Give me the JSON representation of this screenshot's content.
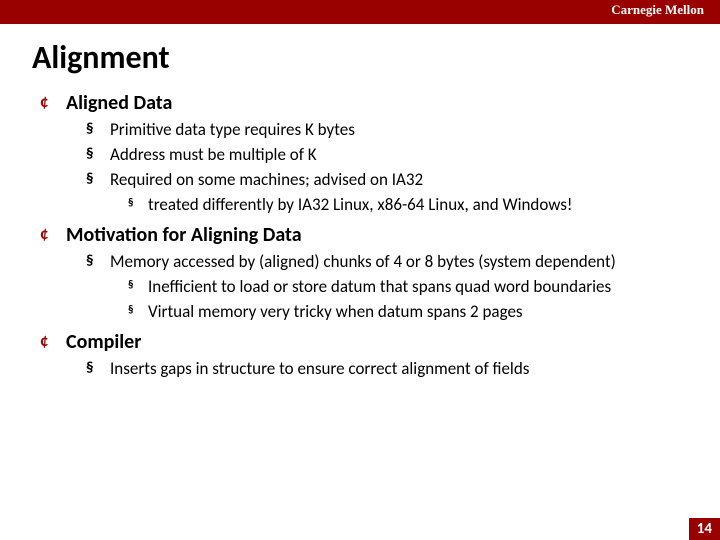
{
  "banner": {
    "institution": "Carnegie Mellon"
  },
  "title": "Alignment",
  "sections": [
    {
      "heading": "Aligned Data",
      "items": [
        {
          "text": "Primitive data type requires K bytes"
        },
        {
          "text": "Address must be multiple of K"
        },
        {
          "text": "Required on some machines; advised on IA32",
          "sub": [
            {
              "text": "treated differently by IA32 Linux, x86-64 Linux, and Windows!"
            }
          ]
        }
      ]
    },
    {
      "heading": "Motivation for Aligning Data",
      "items": [
        {
          "text": "Memory accessed by (aligned) chunks of 4 or 8 bytes (system dependent)",
          "sub": [
            {
              "text": "Inefficient to load or store datum that spans quad word boundaries"
            },
            {
              "text": "Virtual memory very tricky when datum spans 2 pages"
            }
          ]
        }
      ]
    },
    {
      "heading": "Compiler",
      "items": [
        {
          "text": "Inserts gaps in structure to ensure correct alignment of fields"
        }
      ]
    }
  ],
  "page_number": "14"
}
